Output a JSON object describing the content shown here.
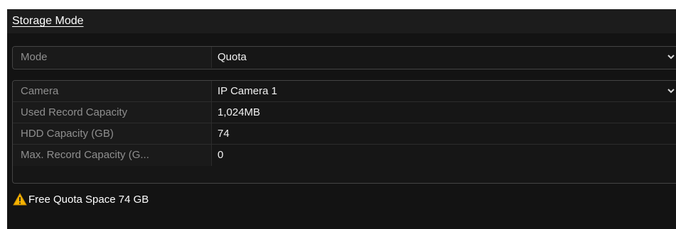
{
  "section": {
    "title": "Storage Mode"
  },
  "mode": {
    "label": "Mode",
    "value": "Quota"
  },
  "camera": {
    "label": "Camera",
    "value": "IP Camera 1"
  },
  "used_record_capacity": {
    "label": "Used Record Capacity",
    "value": "1,024MB"
  },
  "hdd_capacity": {
    "label": "HDD Capacity (GB)",
    "value": "74"
  },
  "max_record_capacity": {
    "label": "Max. Record Capacity (G...",
    "value": "0"
  },
  "notice": {
    "icon": "warning-icon",
    "text": "Free Quota Space 74 GB"
  },
  "colors": {
    "panel_bg": "#131313",
    "label_text": "#8f8f8f",
    "value_text": "#f2f2f2",
    "warning": "#f5b301"
  }
}
